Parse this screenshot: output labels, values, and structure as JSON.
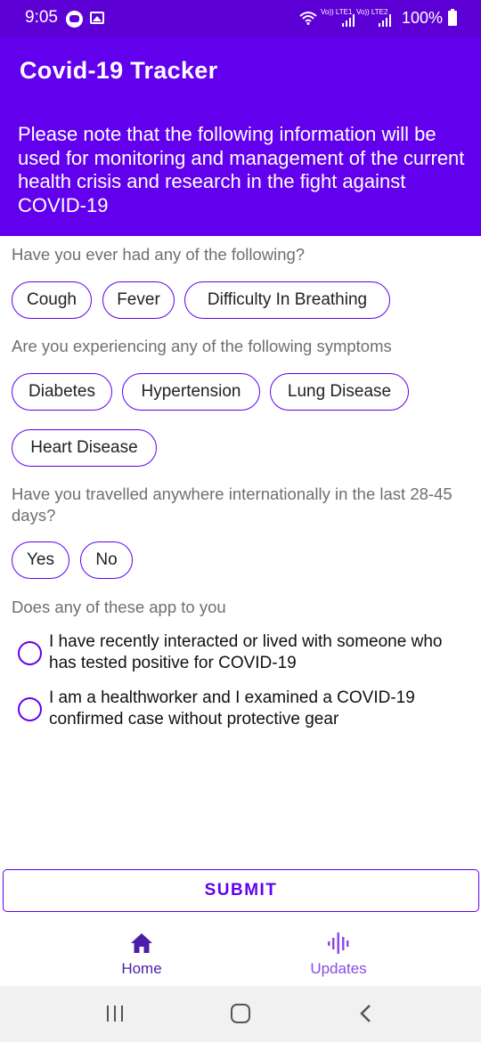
{
  "status_bar": {
    "time": "9:05",
    "sim1_label": "Vo)) LTE1",
    "sim2_label": "Vo)) LTE2",
    "battery": "100%",
    "icons": [
      "chat-icon",
      "gallery-icon",
      "wifi-icon",
      "signal-icon",
      "battery-icon"
    ]
  },
  "header": {
    "title": "Covid-19 Tracker",
    "notice": "Please note that the following information will be used for monitoring and management of the current health crisis and research in the fight against COVID-19"
  },
  "questions": {
    "q1": {
      "text": "Have you ever had any of the following?",
      "options": [
        "Cough",
        "Fever",
        "Difficulty In Breathing"
      ]
    },
    "q2": {
      "text": "Are you experiencing any of the following symptoms",
      "options": [
        "Diabetes",
        "Hypertension",
        "Lung Disease",
        "Heart Disease"
      ]
    },
    "q3": {
      "text": "Have you travelled anywhere internationally in the last 28-45 days?",
      "options": [
        "Yes",
        "No"
      ]
    },
    "q4": {
      "text": "Does any of these app to you",
      "options": [
        "I have recently interacted or lived with someone who has tested positive for COVID-19",
        "I am a healthworker and I examined a COVID-19 confirmed case without protective gear"
      ]
    }
  },
  "submit_label": "SUBMIT",
  "bottom_nav": {
    "home": "Home",
    "updates": "Updates"
  },
  "colors": {
    "primary": "#6200ee",
    "status_bar": "#5c00d6",
    "nav_active": "#4a1ea8",
    "nav_inactive": "#8a4be6"
  }
}
